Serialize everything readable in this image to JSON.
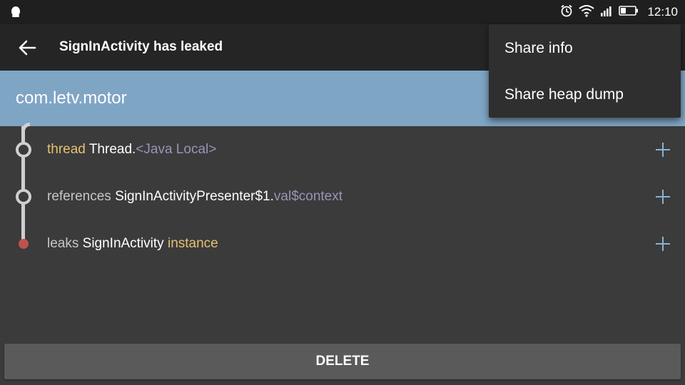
{
  "status_bar": {
    "time": "12:10",
    "icons": [
      "notification-icon",
      "alarm-icon",
      "wifi-icon",
      "signal-icon",
      "battery-icon"
    ]
  },
  "toolbar": {
    "back_icon": "arrow-back-icon",
    "title": "SignInActivity has leaked"
  },
  "overflow_menu": {
    "items": [
      {
        "label": "Share info"
      },
      {
        "label": "Share heap dump"
      }
    ]
  },
  "package": {
    "name": "com.letv.motor"
  },
  "trace": {
    "rows": [
      {
        "kind": "thread",
        "class_name": "Thread.",
        "field": "<Java Local>",
        "expand_icon": "plus-icon"
      },
      {
        "kind": "references",
        "class_name": "SignInActivityPresenter$1.",
        "field": "val$context",
        "expand_icon": "plus-icon"
      },
      {
        "kind": "leaks",
        "class_name": "SignInActivity ",
        "field": "instance",
        "expand_icon": "plus-icon"
      }
    ]
  },
  "actions": {
    "delete_label": "DELETE"
  },
  "colors": {
    "toolbar": "#252525",
    "status_bar": "#1f1f1f",
    "package_header": "#7fa5c5",
    "background": "#3b3b3b",
    "type_highlight": "#e5c170",
    "field_highlight": "#9d92b7",
    "leak_dot": "#c0524d",
    "plus_accent": "#8ab2d3"
  }
}
